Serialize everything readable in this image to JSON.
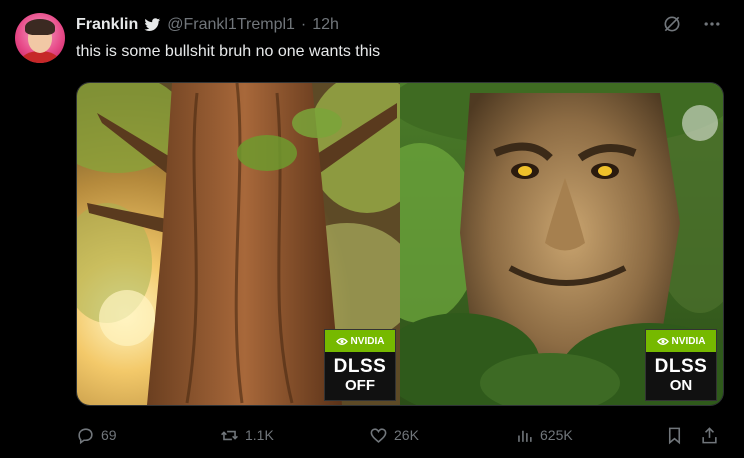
{
  "tweet": {
    "display_name": "Franklin",
    "handle": "@Frankl1Trempl1",
    "separator": "·",
    "time": "12h",
    "text": "this is some bullshit bruh no one wants this"
  },
  "media": {
    "left_badge": {
      "brand": "NVIDIA",
      "title": "DLSS",
      "state": "OFF"
    },
    "right_badge": {
      "brand": "NVIDIA",
      "title": "DLSS",
      "state": "ON"
    }
  },
  "actions": {
    "replies": "69",
    "reposts": "1.1K",
    "likes": "26K",
    "views": "625K"
  },
  "icons": {
    "verified": "bird-icon",
    "grok": "grok-icon",
    "more": "more-icon",
    "reply": "reply-icon",
    "repost": "repost-icon",
    "like": "heart-icon",
    "views": "views-icon",
    "bookmark": "bookmark-icon",
    "share": "share-icon"
  },
  "colors": {
    "nvidia_green": "#76b900",
    "muted": "#71767b",
    "text": "#e7e9ea",
    "background": "#000000"
  }
}
